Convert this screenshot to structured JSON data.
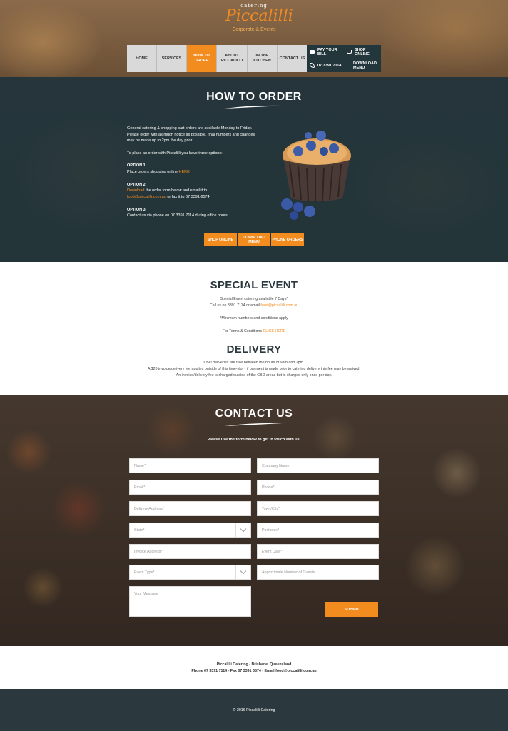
{
  "logo": {
    "small": "catering",
    "main": "Piccalilli",
    "tagline": "Corporate & Events"
  },
  "nav": [
    {
      "label": "HOME"
    },
    {
      "label": "SERVICES"
    },
    {
      "label": "HOW TO ORDER",
      "active": true
    },
    {
      "label": "ABOUT PICCALILLI"
    },
    {
      "label": "IN THE KITCHEN"
    },
    {
      "label": "CONTACT US"
    }
  ],
  "quick": {
    "pay": "PAY YOUR BILL",
    "shop": "SHOP ONLINE",
    "phone": "07 3391 7114",
    "download": "DOWNLOAD MENU"
  },
  "how": {
    "title": "HOW TO ORDER",
    "intro": "General catering & shopping cart orders are available Monday to Friday. Please order with as much notice as possible, final numbers and changes may be made up to 2pm the day prior.",
    "options_intro": "To place an order with Piccalilli you have three options:",
    "opt1_title": "OPTION 1.",
    "opt1_text": "Place orders shopping online ",
    "opt1_link": "HERE",
    "opt2_title": "OPTION 2.",
    "opt2_link": "Download",
    "opt2_text": " the order form below and email it to ",
    "opt2_email": "food@piccalilli.com.au",
    "opt2_fax": " or fax it to 07 3391 6574.",
    "opt3_title": "OPTION 3.",
    "opt3_text": "Contact us via phone on 07 3391 7114 during office hours.",
    "buttons": [
      "SHOP ONLINE",
      "DOWNLOAD MENU",
      "PHONE ORDERS"
    ]
  },
  "special": {
    "title": "SPECIAL EVENT",
    "line1": "Special Event catering available 7 Days*",
    "line2": "Call us on 3391 7114 or email ",
    "line2_email": "food@piccalilli.com.au",
    "line3": "*Minimum numbers and conditions apply",
    "line4": "For Terms & Conditions ",
    "line4_link": "CLICK HERE"
  },
  "delivery": {
    "title": "DELIVERY",
    "line1": "CBD deliveries are free between the hours of 9am and 2pm.",
    "line2": "A $20 invoice/delivery fee applies outside of this time-slot - if payment is made prior to catering delivery this fee may be waived.",
    "line3": "An invoice/delivery fee is charged outside of the CBD areas but is charged only once per day."
  },
  "contact": {
    "title": "CONTACT US",
    "intro": "Please use the form below to get in touch with us.",
    "fields": {
      "name": "Name*",
      "company": "Company Name",
      "email": "Email*",
      "phone": "Phone*",
      "address": "Delivery Address*",
      "town": "Town/City*",
      "state": "State*",
      "postcode": "Postcode*",
      "invoice": "Invoice Address*",
      "event_date": "Event Date*",
      "event_type": "Event Type*",
      "guests": "Approximate Number of Guests",
      "message": "Your Message"
    },
    "submit": "SUBMIT"
  },
  "footer": {
    "line1": "Piccalilli Catering - Brisbane, Queensland",
    "line2": "Phone 07 3391 7114 - Fax 07 3391 6574 - Email food@piccalilli.com.au",
    "copyright": "© 2016 Piccalilli Catering"
  },
  "colors": {
    "accent": "#f28c1f",
    "dark": "#2b393e"
  }
}
